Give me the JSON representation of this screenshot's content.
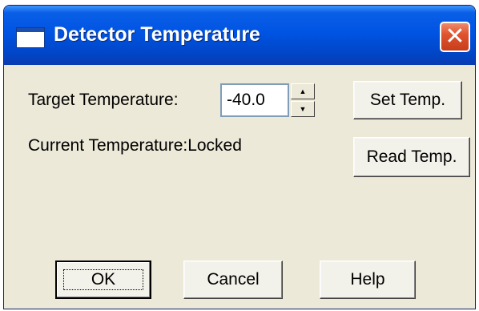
{
  "window": {
    "title": "Detector Temperature",
    "close_glyph": "✕"
  },
  "form": {
    "target_label": "Target Temperature:",
    "target_value": "-40.0",
    "current_label": "Current Temperature:Locked"
  },
  "spinner": {
    "up_glyph": "▲",
    "down_glyph": "▼"
  },
  "buttons": {
    "set_temp": "Set Temp.",
    "read_temp": "Read Temp.",
    "ok": "OK",
    "cancel": "Cancel",
    "help": "Help"
  },
  "colors": {
    "titlebar": "#0054e3",
    "dialog_bg": "#ece9d8",
    "close_button": "#e0532f"
  },
  "icons": {
    "title_icon": "window-icon",
    "close_icon": "close-icon",
    "spin_up_icon": "arrow-up-icon",
    "spin_down_icon": "arrow-down-icon"
  }
}
